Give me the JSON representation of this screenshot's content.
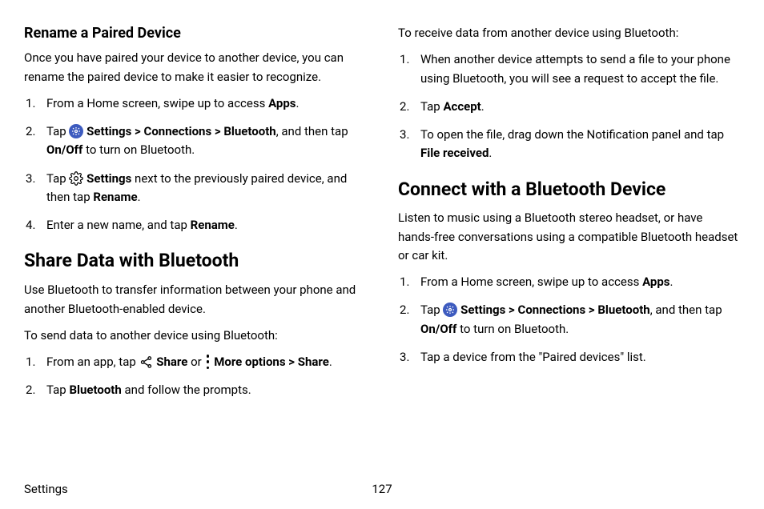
{
  "footer": {
    "section": "Settings",
    "page": "127"
  },
  "left": {
    "h3": "Rename a Paired Device",
    "p1": "Once you have paired your device to another device, you can rename the paired device to make it easier to recognize.",
    "li1_a": "From a Home screen, swipe up to access ",
    "li1_b": "Apps",
    "li1_c": ".",
    "li2_a": "Tap ",
    "li2_b": "Settings",
    "li2_c": " > ",
    "li2_d": "Connections",
    "li2_e": " > ",
    "li2_f": "Bluetooth",
    "li2_g": ", and then tap ",
    "li2_h": "On/Off",
    "li2_i": " to turn on Bluetooth.",
    "li3_a": "Tap ",
    "li3_b": "Settings",
    "li3_c": " next to the previously paired device, and then tap ",
    "li3_d": "Rename",
    "li3_e": ".",
    "li4_a": "Enter a new name, and tap ",
    "li4_b": "Rename",
    "li4_c": ".",
    "h2": "Share Data with Bluetooth",
    "p2": "Use Bluetooth to transfer information between your phone and another Bluetooth-enabled device.",
    "p3": "To send data to another device using Bluetooth:",
    "s1_a": "From an app, tap ",
    "s1_b": "Share",
    "s1_c": " or ",
    "s1_d": "More options",
    "s1_e": " > ",
    "s1_f": "Share",
    "s1_g": ".",
    "s2_a": "Tap ",
    "s2_b": "Bluetooth",
    "s2_c": " and follow the prompts."
  },
  "right": {
    "p1": "To receive data from another device using Bluetooth:",
    "r1": "When another device attempts to send a file to your phone using Bluetooth, you will see a request to accept the file.",
    "r2_a": "Tap ",
    "r2_b": "Accept",
    "r2_c": ".",
    "r3_a": "To open the file, drag down the Notification panel and tap ",
    "r3_b": "File received",
    "r3_c": ".",
    "h2": "Connect with a Bluetooth Device",
    "p2": "Listen to music using a Bluetooth stereo headset, or have hands-free conversations using a compatible Bluetooth headset or car kit.",
    "c1_a": "From a Home screen, swipe up to access ",
    "c1_b": "Apps",
    "c1_c": ".",
    "c2_a": "Tap ",
    "c2_b": "Settings",
    "c2_c": " > ",
    "c2_d": "Connections",
    "c2_e": " > ",
    "c2_f": "Bluetooth",
    "c2_g": ", and then tap ",
    "c2_h": "On/Off",
    "c2_i": " to turn on Bluetooth.",
    "c3": "Tap a device from the \"Paired devices\" list."
  }
}
